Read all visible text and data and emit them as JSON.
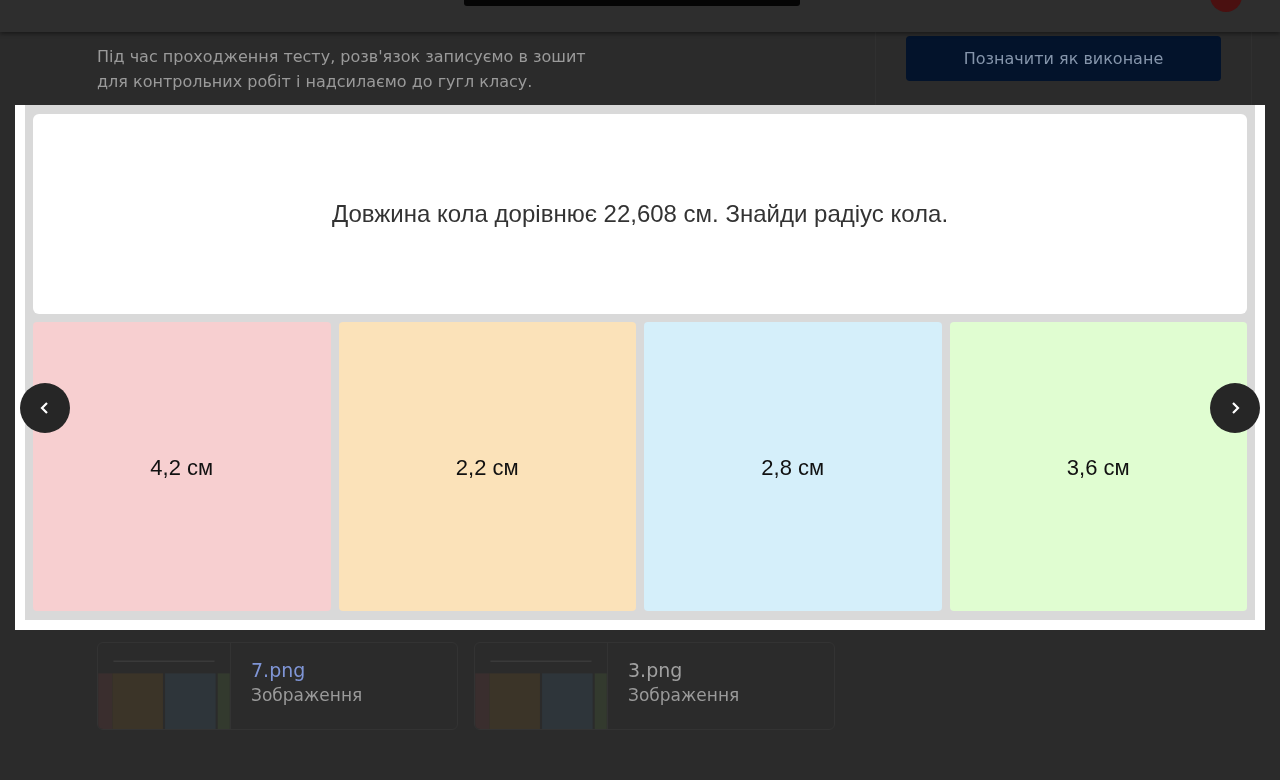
{
  "description": "Під час проходження тесту, розв'язок записуємо в зошит для контрольних робіт і надсилаємо до гугл класу.",
  "mark_done_button": "Позначити як виконане",
  "attachments": [
    {
      "title": "7.png",
      "type": "Зображення",
      "highlighted": true
    },
    {
      "title": "3.png",
      "type": "Зображення",
      "highlighted": false
    }
  ],
  "lightbox": {
    "question": "Довжина кола дорівнює 22,608 см. Знайди радіус кола.",
    "answers": [
      {
        "text": "4,2 см",
        "color": "#f7cfd0"
      },
      {
        "text": "2,2 см",
        "color": "#fbe2b9"
      },
      {
        "text": "2,8 см",
        "color": "#d5effa"
      },
      {
        "text": "3,6 см",
        "color": "#e0fdd1"
      }
    ]
  }
}
